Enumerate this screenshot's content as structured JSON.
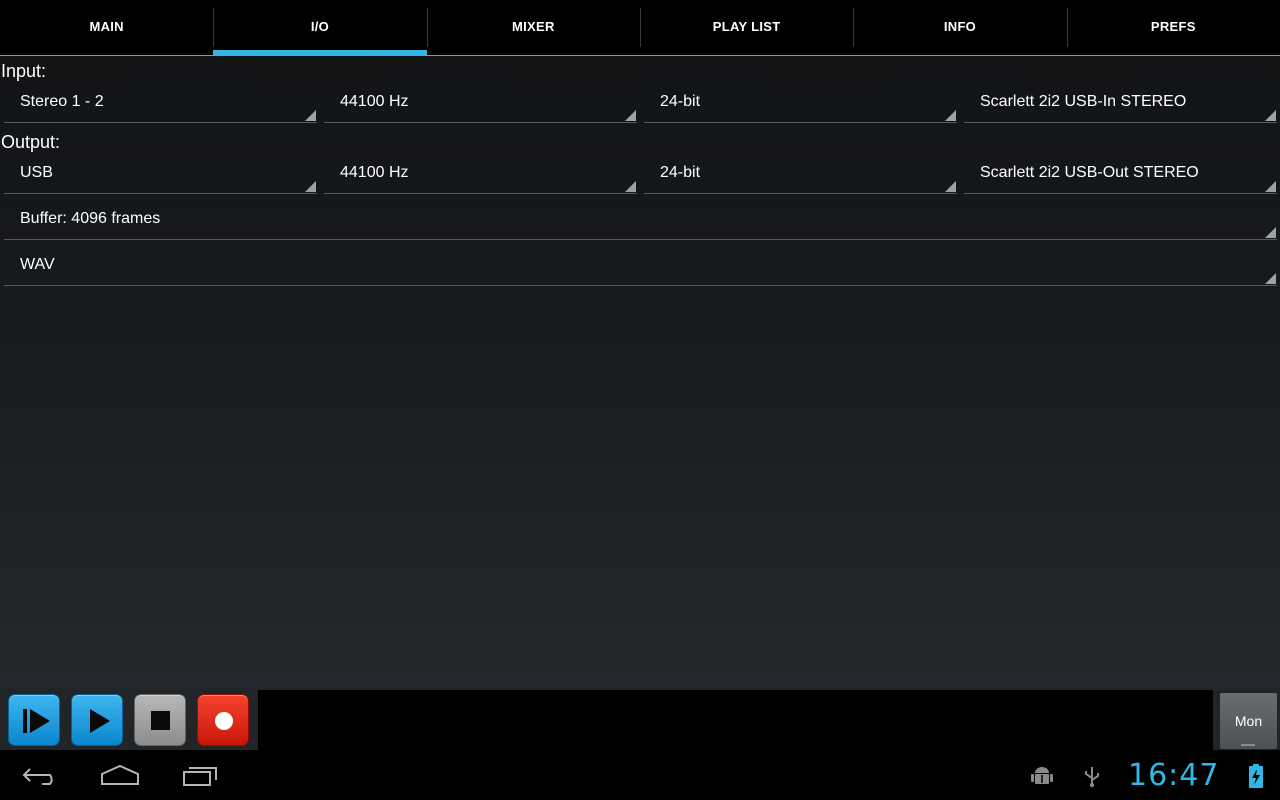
{
  "tabs": [
    {
      "label": "MAIN",
      "selected": false
    },
    {
      "label": "I/O",
      "selected": true
    },
    {
      "label": "MIXER",
      "selected": false
    },
    {
      "label": "PLAY LIST",
      "selected": false
    },
    {
      "label": "INFO",
      "selected": false
    },
    {
      "label": "PREFS",
      "selected": false
    }
  ],
  "input": {
    "label": "Input:",
    "channels": "Stereo 1 - 2",
    "sample_rate": "44100 Hz",
    "bit_depth": "24-bit",
    "device": "Scarlett 2i2 USB-In STEREO"
  },
  "output": {
    "label": "Output:",
    "channels": "USB",
    "sample_rate": "44100 Hz",
    "bit_depth": "24-bit",
    "device": "Scarlett 2i2 USB-Out STEREO"
  },
  "buffer": "Buffer: 4096 frames",
  "format": "WAV",
  "transport": {
    "monitor_label": "Mon"
  },
  "status_bar": {
    "time": "16:47"
  },
  "colors": {
    "accent": "#33b5e5",
    "play_blue": "#1a9be0",
    "stop_gray": "#a0a0a0",
    "record_red": "#e32b1a"
  }
}
